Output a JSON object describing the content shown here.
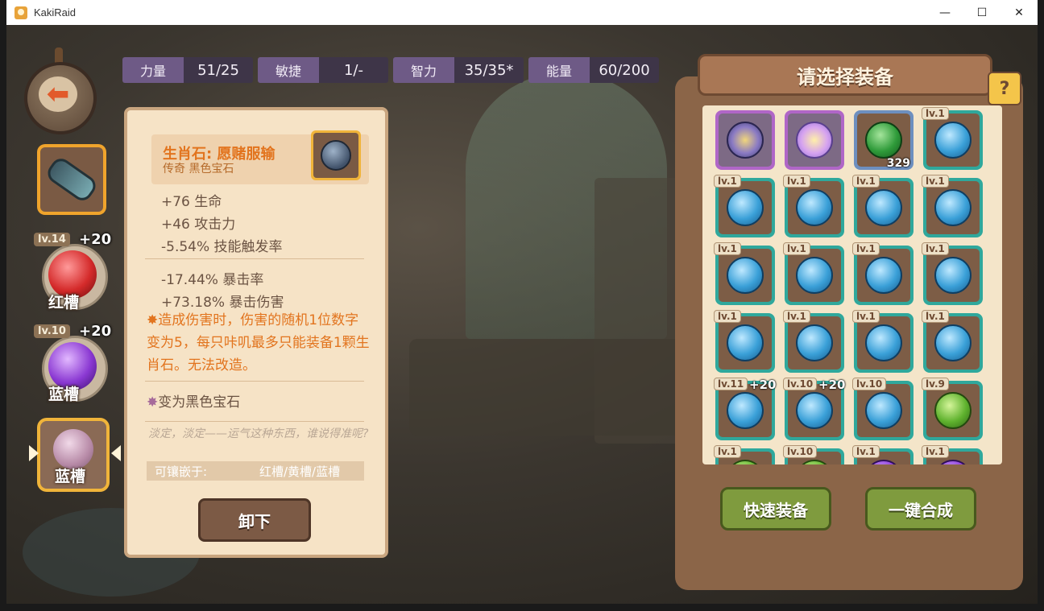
{
  "window": {
    "title": "KakiRaid",
    "minimize": "—",
    "maximize": "☐",
    "close": "✕"
  },
  "stats": [
    {
      "label": "力量",
      "value": "51/25"
    },
    {
      "label": "敏捷",
      "value": "1/-"
    },
    {
      "label": "智力",
      "value": "35/35*"
    },
    {
      "label": "能量",
      "value": "60/200"
    }
  ],
  "slots": {
    "red": {
      "level": "lv.14",
      "plus": "+20",
      "label": "红槽"
    },
    "blue1": {
      "level": "lv.10",
      "plus": "+20",
      "label": "蓝槽"
    },
    "selected_label": "蓝槽"
  },
  "detail": {
    "title": "生肖石: 愿赌服输",
    "subtitle": "传奇 黑色宝石",
    "lines": [
      "+76 生命",
      "+46 攻击力",
      "-5.54% 技能触发率",
      "-17.44% 暴击率",
      "+73.18% 暴击伤害"
    ],
    "effect": "造成伤害时，伤害的随机1位数字变为5，每只咔叽最多只能装备1颗生肖石。无法改造。",
    "transform": "变为黑色宝石",
    "flavor": "淡定，淡定——运气这种东西，谁说得准呢?",
    "socket_key": "可镶嵌于:",
    "socket_value": "红槽/黄槽/蓝槽",
    "unequip": "卸下"
  },
  "panel": {
    "title": "请选择装备",
    "help": "?",
    "quick_equip": "快速装备",
    "merge_all": "一键合成"
  },
  "inventory": [
    {
      "frame": "purple",
      "gem": "star",
      "level": "",
      "plus": "",
      "count": ""
    },
    {
      "frame": "purple",
      "gem": "prism",
      "level": "",
      "plus": "",
      "count": ""
    },
    {
      "frame": "blue",
      "gem": "emer",
      "level": "",
      "plus": "",
      "count": "329"
    },
    {
      "frame": "teal",
      "gem": "blue",
      "level": "lv.1",
      "plus": "",
      "count": ""
    },
    {
      "frame": "teal",
      "gem": "blue",
      "level": "lv.1",
      "plus": "",
      "count": ""
    },
    {
      "frame": "teal",
      "gem": "blue",
      "level": "lv.1",
      "plus": "",
      "count": ""
    },
    {
      "frame": "teal",
      "gem": "blue",
      "level": "lv.1",
      "plus": "",
      "count": ""
    },
    {
      "frame": "teal",
      "gem": "blue",
      "level": "lv.1",
      "plus": "",
      "count": ""
    },
    {
      "frame": "teal",
      "gem": "blue",
      "level": "lv.1",
      "plus": "",
      "count": ""
    },
    {
      "frame": "teal",
      "gem": "blue",
      "level": "lv.1",
      "plus": "",
      "count": ""
    },
    {
      "frame": "teal",
      "gem": "blue",
      "level": "lv.1",
      "plus": "",
      "count": ""
    },
    {
      "frame": "teal",
      "gem": "blue",
      "level": "lv.1",
      "plus": "",
      "count": ""
    },
    {
      "frame": "teal",
      "gem": "blue",
      "level": "lv.1",
      "plus": "",
      "count": ""
    },
    {
      "frame": "teal",
      "gem": "blue",
      "level": "lv.1",
      "plus": "",
      "count": ""
    },
    {
      "frame": "teal",
      "gem": "blue",
      "level": "lv.1",
      "plus": "",
      "count": ""
    },
    {
      "frame": "teal",
      "gem": "blue",
      "level": "lv.1",
      "plus": "",
      "count": ""
    },
    {
      "frame": "teal",
      "gem": "blue",
      "level": "lv.11",
      "plus": "+20",
      "count": ""
    },
    {
      "frame": "teal",
      "gem": "blue",
      "level": "lv.10",
      "plus": "+20",
      "count": ""
    },
    {
      "frame": "teal",
      "gem": "blue",
      "level": "lv.10",
      "plus": "",
      "count": ""
    },
    {
      "frame": "teal",
      "gem": "green",
      "level": "lv.9",
      "plus": "",
      "count": ""
    },
    {
      "frame": "teal",
      "gem": "green",
      "level": "lv.1",
      "plus": "",
      "count": ""
    },
    {
      "frame": "teal",
      "gem": "green",
      "level": "lv.10",
      "plus": "",
      "count": ""
    },
    {
      "frame": "teal",
      "gem": "violet",
      "level": "lv.1",
      "plus": "",
      "count": ""
    },
    {
      "frame": "teal",
      "gem": "violet",
      "level": "lv.1",
      "plus": "",
      "count": ""
    }
  ],
  "colors": {
    "accent_orange": "#e2741e",
    "panel_brown": "#8b6548",
    "stat_purple": "#6e5a86",
    "button_green": "#7f9b3e"
  }
}
